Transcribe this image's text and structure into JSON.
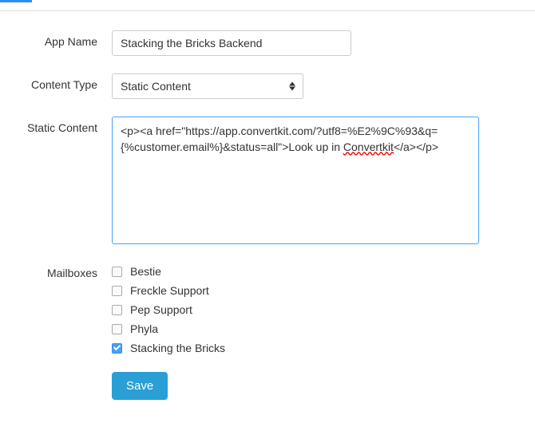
{
  "labels": {
    "app_name": "App Name",
    "content_type": "Content Type",
    "static_content": "Static Content",
    "mailboxes": "Mailboxes"
  },
  "fields": {
    "app_name_value": "Stacking the Bricks Backend",
    "content_type_value": "Static Content",
    "static_content_pre": "<p><a href=\"https://app.convertkit.com/?utf8=%E2%9C%93&q={%customer.email%}&status=all\">Look up in ",
    "static_content_mis": "Convertkit",
    "static_content_post": "</a></p>"
  },
  "mailboxes": [
    {
      "label": "Bestie",
      "checked": false
    },
    {
      "label": "Freckle Support",
      "checked": false
    },
    {
      "label": "Pep Support",
      "checked": false
    },
    {
      "label": "Phyla",
      "checked": false
    },
    {
      "label": "Stacking the Bricks",
      "checked": true
    }
  ],
  "buttons": {
    "save": "Save"
  }
}
